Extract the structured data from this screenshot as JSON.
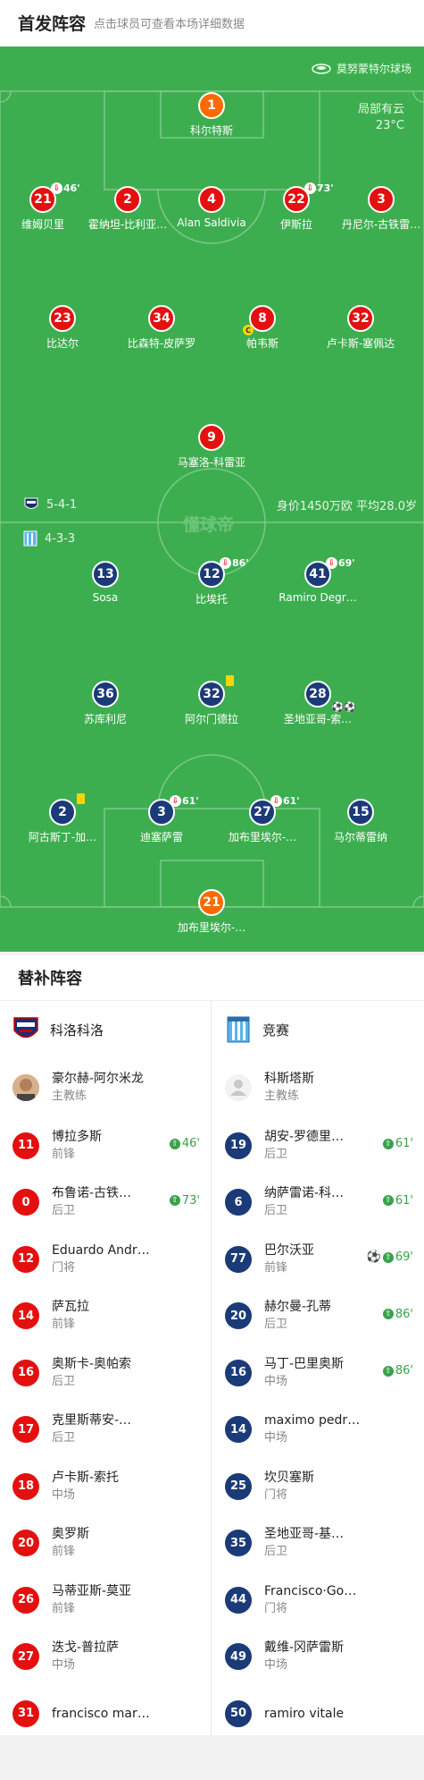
{
  "header": {
    "title": "首发阵容",
    "subtitle": "点击球员可查看本场详细数据"
  },
  "pitch": {
    "stadium": "莫努蒙特尔球场",
    "weather": "局部有云",
    "temperature": "23°C",
    "home_formation": "5-4-1",
    "away_formation": "4-3-3",
    "value_text": "身价1450万欧 平均28.0岁",
    "watermark": "懂球帝",
    "home_players": [
      {
        "number": "1",
        "name": "科尔特斯",
        "color": "orange"
      },
      {
        "number": "21",
        "name": "维姆贝里",
        "color": "red",
        "sub": "46'"
      },
      {
        "number": "2",
        "name": "霍纳坦-比利亚…",
        "color": "red"
      },
      {
        "number": "4",
        "name": "Alan Saldivia",
        "color": "red"
      },
      {
        "number": "22",
        "name": "伊斯拉",
        "color": "red",
        "sub": "73'"
      },
      {
        "number": "3",
        "name": "丹尼尔-古铁雷…",
        "color": "red"
      },
      {
        "number": "23",
        "name": "比达尔",
        "color": "red"
      },
      {
        "number": "34",
        "name": "比森特-皮萨罗",
        "color": "red"
      },
      {
        "number": "8",
        "name": "帕韦斯",
        "color": "red",
        "captain": "C"
      },
      {
        "number": "32",
        "name": "卢卡斯-塞佩达",
        "color": "red"
      },
      {
        "number": "9",
        "name": "马塞洛-科雷亚",
        "color": "red"
      }
    ],
    "away_players": [
      {
        "number": "13",
        "name": "Sosa",
        "color": "navy"
      },
      {
        "number": "12",
        "name": "比埃托",
        "color": "navy",
        "sub": "86'"
      },
      {
        "number": "41",
        "name": "Ramiro Degr…",
        "color": "navy",
        "sub": "69'"
      },
      {
        "number": "36",
        "name": "苏库利尼",
        "color": "navy"
      },
      {
        "number": "32",
        "name": "阿尔门德拉",
        "color": "navy",
        "yellow": true
      },
      {
        "number": "28",
        "name": "圣地亚哥-索…",
        "color": "navy",
        "goals": "⚽⚽"
      },
      {
        "number": "2",
        "name": "阿古斯丁-加…",
        "color": "navy",
        "yellow": true
      },
      {
        "number": "3",
        "name": "迪塞萨雷",
        "color": "navy",
        "sub": "61'"
      },
      {
        "number": "27",
        "name": "加布里埃尔-…",
        "color": "navy",
        "sub": "61'"
      },
      {
        "number": "15",
        "name": "马尔蒂雷纳",
        "color": "navy"
      },
      {
        "number": "21",
        "name": "加布里埃尔-…",
        "color": "orange"
      }
    ]
  },
  "subs_section": {
    "title": "替补阵容",
    "home": {
      "team": "科洛科洛",
      "coach": {
        "name": "豪尔赫-阿尔米龙",
        "role": "主教练"
      },
      "players": [
        {
          "number": "11",
          "name": "博拉多斯",
          "pos": "前锋",
          "minute": "46'"
        },
        {
          "number": "0",
          "name": "布鲁诺-古铁…",
          "pos": "后卫",
          "minute": "73'"
        },
        {
          "number": "12",
          "name": "Eduardo Andr…",
          "pos": "门将"
        },
        {
          "number": "14",
          "name": "萨瓦拉",
          "pos": "前锋"
        },
        {
          "number": "16",
          "name": "奥斯卡-奥帕索",
          "pos": "后卫"
        },
        {
          "number": "17",
          "name": "克里斯蒂安-…",
          "pos": "后卫"
        },
        {
          "number": "18",
          "name": "卢卡斯-索托",
          "pos": "中场"
        },
        {
          "number": "20",
          "name": "奥罗斯",
          "pos": "前锋"
        },
        {
          "number": "26",
          "name": "马蒂亚斯-莫亚",
          "pos": "前锋"
        },
        {
          "number": "27",
          "name": "迭戈-普拉萨",
          "pos": "中场"
        },
        {
          "number": "31",
          "name": "francisco mar…",
          "pos": ""
        }
      ]
    },
    "away": {
      "team": "竞赛",
      "coach": {
        "name": "科斯塔斯",
        "role": "主教练"
      },
      "players": [
        {
          "number": "19",
          "name": "胡安-罗德里…",
          "pos": "后卫",
          "minute": "61'"
        },
        {
          "number": "6",
          "name": "纳萨雷诺-科…",
          "pos": "后卫",
          "minute": "61'"
        },
        {
          "number": "77",
          "name": "巴尔沃亚",
          "pos": "前锋",
          "minute": "69'",
          "goal": "⚽"
        },
        {
          "number": "20",
          "name": "赫尔曼-孔蒂",
          "pos": "后卫",
          "minute": "86'"
        },
        {
          "number": "16",
          "name": "马丁-巴里奥斯",
          "pos": "中场",
          "minute": "86'"
        },
        {
          "number": "14",
          "name": "maximo pedr…",
          "pos": "中场"
        },
        {
          "number": "25",
          "name": "坎贝塞斯",
          "pos": "门将"
        },
        {
          "number": "35",
          "name": "圣地亚哥-基…",
          "pos": "后卫"
        },
        {
          "number": "44",
          "name": "Francisco·Go…",
          "pos": "门将"
        },
        {
          "number": "49",
          "name": "戴维-冈萨雷斯",
          "pos": "中场"
        },
        {
          "number": "50",
          "name": "ramiro vitale",
          "pos": ""
        }
      ]
    }
  },
  "colors": {
    "pitch": "#3dae4f",
    "home": "#e41010",
    "away": "#1b3a78",
    "gk": "#ff6a00",
    "accent": "#3aa14b"
  }
}
